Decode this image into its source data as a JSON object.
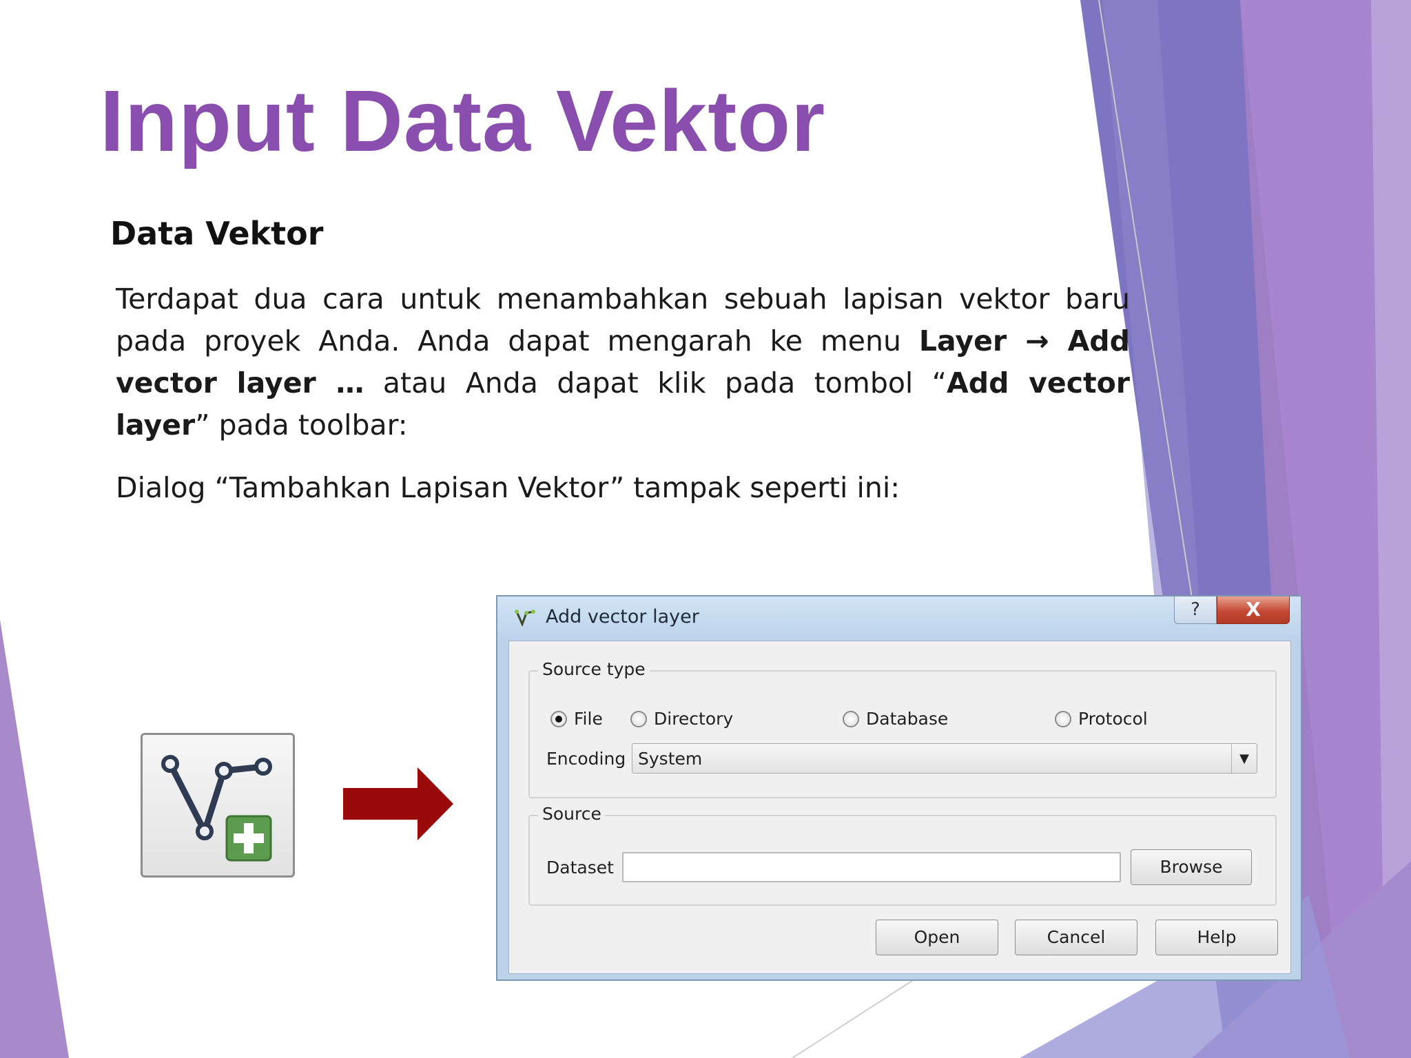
{
  "slide": {
    "title": "Input Data Vektor",
    "subtitle": "Data Vektor",
    "paragraph1": {
      "t1": "Terdapat dua cara untuk menambahkan sebuah lapisan vektor baru pada proyek Anda. Anda dapat mengarah ke menu ",
      "b1": "Layer → Add vector layer …",
      "t2": " atau Anda dapat klik pada tombol  “",
      "b2": "Add vector layer",
      "t3": "” pada toolbar:"
    },
    "paragraph2": "Dialog “Tambahkan Lapisan Vektor” tampak seperti ini:",
    "colors": {
      "title": "#8a4fae",
      "arrow": "#9b0a0a",
      "accent_purple": "#8e5cb8",
      "accent_blue": "#7d79c4"
    }
  },
  "toolbar_icon": {
    "icon": "add-vector-layer-icon"
  },
  "dialog": {
    "title": "Add vector layer",
    "help_label": "?",
    "close_label": "X",
    "source_type": {
      "legend": "Source type",
      "options": [
        "File",
        "Directory",
        "Database",
        "Protocol"
      ],
      "selected": "File",
      "encoding_label": "Encoding",
      "encoding_value": "System"
    },
    "source": {
      "legend": "Source",
      "dataset_label": "Dataset",
      "dataset_value": "",
      "browse_label": "Browse"
    },
    "buttons": {
      "open": "Open",
      "cancel": "Cancel",
      "help": "Help"
    }
  }
}
